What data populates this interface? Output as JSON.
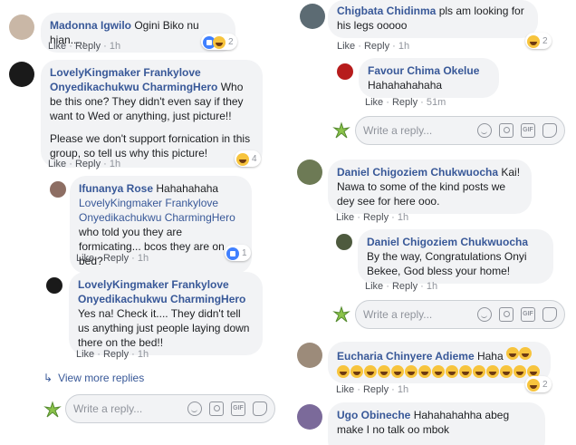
{
  "left": {
    "c1": {
      "author": "Madonna Igwilo",
      "text": "Ogini Biko nu hian.....",
      "like": "Like",
      "reply": "Reply",
      "time": "1h",
      "count": "2"
    },
    "c2": {
      "author": "LovelyKingmaker Frankylove Onyedikachukwu CharmingHero",
      "text1": "Who be this one? They didn't even say if they want to Wed or anything, just picture!!",
      "text2": "Please we don't support fornication in this group, so tell us why this picture!",
      "like": "Like",
      "reply": "Reply",
      "time": "1h",
      "count": "4"
    },
    "r1": {
      "author": "Ifunanya Rose",
      "mention": "LovelyKingmaker Frankylove Onyedikachukwu CharmingHero",
      "pre": "Hahahahaha",
      "text": "who told you they are formicating... bcos they are on bed?",
      "like": "Like",
      "reply": "Reply",
      "time": "1h",
      "count": "1"
    },
    "r2": {
      "author": "LovelyKingmaker Frankylove Onyedikachukwu CharmingHero",
      "text": "Yes na! Check it.... They didn't tell us anything just people laying down there on the bed!!",
      "like": "Like",
      "reply": "Reply",
      "time": "1h"
    },
    "view_more": "View more replies",
    "reply_placeholder": "Write a reply..."
  },
  "right": {
    "c1": {
      "author": "Chigbata Chidinma",
      "text": "pls am looking for his legs ooooo",
      "like": "Like",
      "reply": "Reply",
      "time": "1h",
      "count": "2"
    },
    "r1": {
      "author": "Favour Chima Okelue",
      "text": "Hahahahahaha",
      "like": "Like",
      "reply": "Reply",
      "time": "51m"
    },
    "reply_placeholder_1": "Write a reply...",
    "c2": {
      "author": "Daniel Chigoziem Chukwuocha",
      "text": "Kai! Nawa to some of the kind posts we dey see for here ooo.",
      "like": "Like",
      "reply": "Reply",
      "time": "1h"
    },
    "r2": {
      "author": "Daniel Chigoziem Chukwuocha",
      "text": "By the way, Congratulations Onyi Bekee, God bless your home!",
      "like": "Like",
      "reply": "Reply",
      "time": "1h"
    },
    "reply_placeholder_2": "Write a reply...",
    "c3": {
      "author": "Eucharia Chinyere Adieme",
      "text": "Haha",
      "like": "Like",
      "reply": "Reply",
      "time": "1h",
      "count": "2"
    },
    "c4": {
      "author": "Ugo Obineche",
      "text": "Hahahahahha abeg make I no talk oo mbok"
    }
  }
}
